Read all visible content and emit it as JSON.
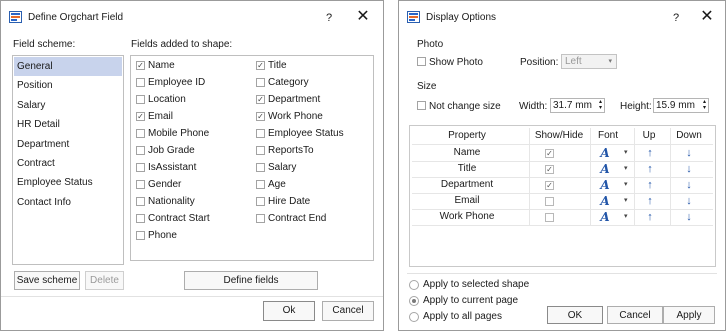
{
  "orgchart_dialog": {
    "title": "Define Orgchart Field",
    "help": "?",
    "close": "✕",
    "field_scheme_label": "Field scheme:",
    "fields_label": "Fields added to shape:",
    "schemes": [
      {
        "label": "General",
        "selected": true
      },
      {
        "label": "Position",
        "selected": false
      },
      {
        "label": "Salary",
        "selected": false
      },
      {
        "label": "HR Detail",
        "selected": false
      },
      {
        "label": "Department",
        "selected": false
      },
      {
        "label": "Contract",
        "selected": false
      },
      {
        "label": "Employee Status",
        "selected": false
      },
      {
        "label": "Contact Info",
        "selected": false
      }
    ],
    "fields_left": [
      {
        "label": "Name",
        "checked": true
      },
      {
        "label": "Employee ID",
        "checked": false
      },
      {
        "label": "Location",
        "checked": false
      },
      {
        "label": "Email",
        "checked": true
      },
      {
        "label": "Mobile Phone",
        "checked": false
      },
      {
        "label": "Job Grade",
        "checked": false
      },
      {
        "label": "IsAssistant",
        "checked": false
      },
      {
        "label": "Gender",
        "checked": false
      },
      {
        "label": "Nationality",
        "checked": false
      },
      {
        "label": "Contract Start",
        "checked": false
      },
      {
        "label": "Phone",
        "checked": false
      }
    ],
    "fields_right": [
      {
        "label": "Title",
        "checked": true
      },
      {
        "label": "Category",
        "checked": false
      },
      {
        "label": "Department",
        "checked": true
      },
      {
        "label": "Work Phone",
        "checked": true
      },
      {
        "label": "Employee Status",
        "checked": false
      },
      {
        "label": "ReportsTo",
        "checked": false
      },
      {
        "label": "Salary",
        "checked": false
      },
      {
        "label": "Age",
        "checked": false
      },
      {
        "label": "Hire Date",
        "checked": false
      },
      {
        "label": "Contract End",
        "checked": false
      }
    ],
    "save_scheme": "Save scheme",
    "delete": "Delete",
    "define_fields": "Define fields",
    "ok": "Ok",
    "cancel": "Cancel"
  },
  "display_dialog": {
    "title": "Display Options",
    "help": "?",
    "close": "✕",
    "photo_section": "Photo",
    "show_photo": "Show Photo",
    "show_photo_checked": false,
    "position_label": "Position:",
    "position_value": "Left",
    "size_section": "Size",
    "not_change_size": "Not change size",
    "not_change_size_checked": false,
    "width_label": "Width:",
    "width_value": "31.7 mm",
    "height_label": "Height:",
    "height_value": "15.9 mm",
    "columns": {
      "property": "Property",
      "show_hide": "Show/Hide",
      "font": "Font",
      "up": "Up",
      "down": "Down"
    },
    "rows": [
      {
        "property": "Name",
        "show": true
      },
      {
        "property": "Title",
        "show": true
      },
      {
        "property": "Department",
        "show": true
      },
      {
        "property": "Email",
        "show": false
      },
      {
        "property": "Work Phone",
        "show": false
      }
    ],
    "apply_options": [
      {
        "label": "Apply to selected shape",
        "selected": false
      },
      {
        "label": "Apply to current page",
        "selected": true
      },
      {
        "label": "Apply to all pages",
        "selected": false
      }
    ],
    "ok": "OK",
    "cancel": "Cancel",
    "apply": "Apply",
    "icons": {
      "font": "font-icon",
      "up": "arrow-up-icon",
      "down": "arrow-down-icon"
    }
  },
  "colors": {
    "selection": "#c8d3ec",
    "accent": "#2356a8"
  }
}
